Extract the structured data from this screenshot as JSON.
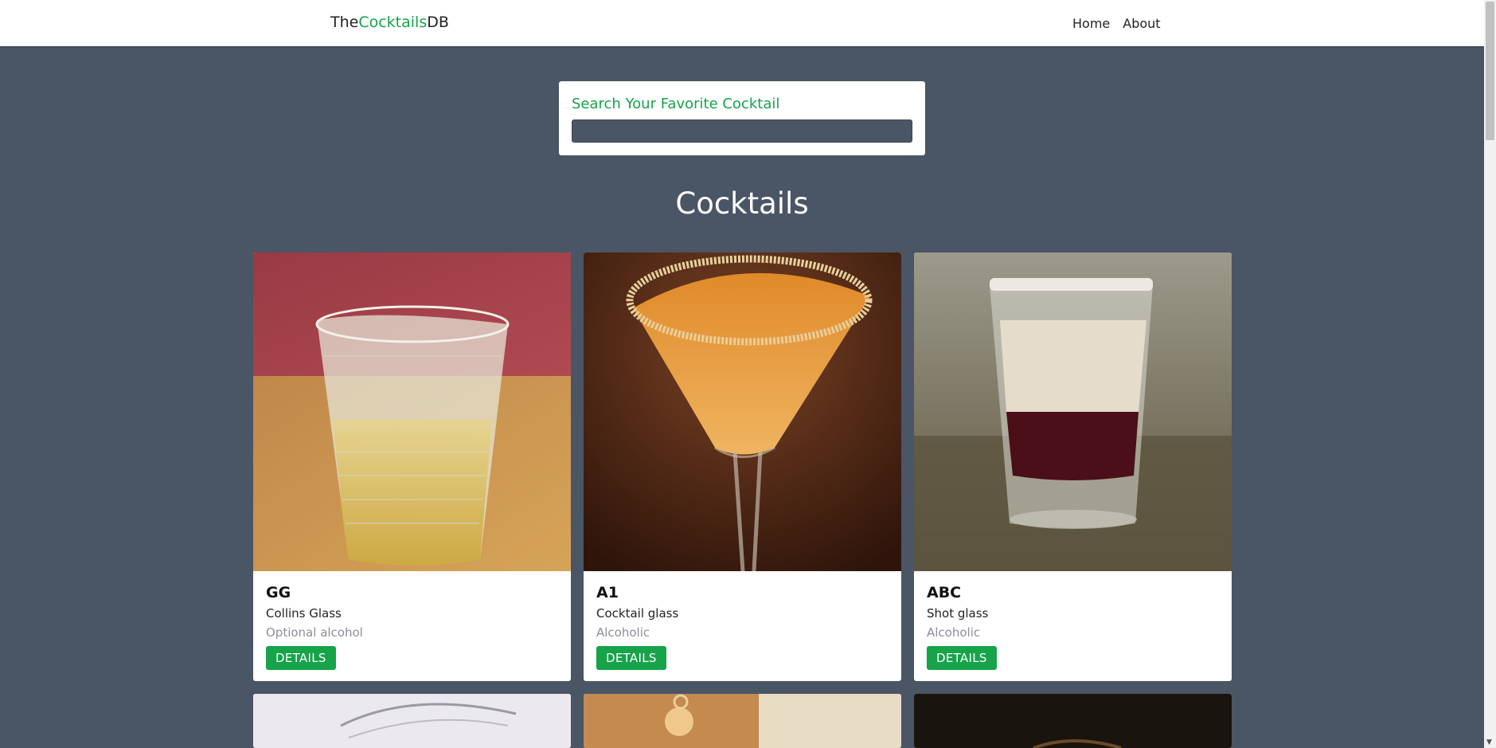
{
  "navbar": {
    "logo_prefix": "The",
    "logo_accent": "Cocktails",
    "logo_suffix": "DB",
    "links": [
      "Home",
      "About"
    ]
  },
  "search": {
    "label": "Search Your Favorite Cocktail",
    "value": ""
  },
  "section_title": "Cocktails",
  "cards": [
    {
      "name": "GG",
      "glass": "Collins Glass",
      "alcohol": "Optional alcohol",
      "button": "DETAILS"
    },
    {
      "name": "A1",
      "glass": "Cocktail glass",
      "alcohol": "Alcoholic",
      "button": "DETAILS"
    },
    {
      "name": "ABC",
      "glass": "Shot glass",
      "alcohol": "Alcoholic",
      "button": "DETAILS"
    }
  ],
  "colors": {
    "accent": "#16a34a",
    "background": "#4a5565",
    "card": "#ffffff"
  }
}
